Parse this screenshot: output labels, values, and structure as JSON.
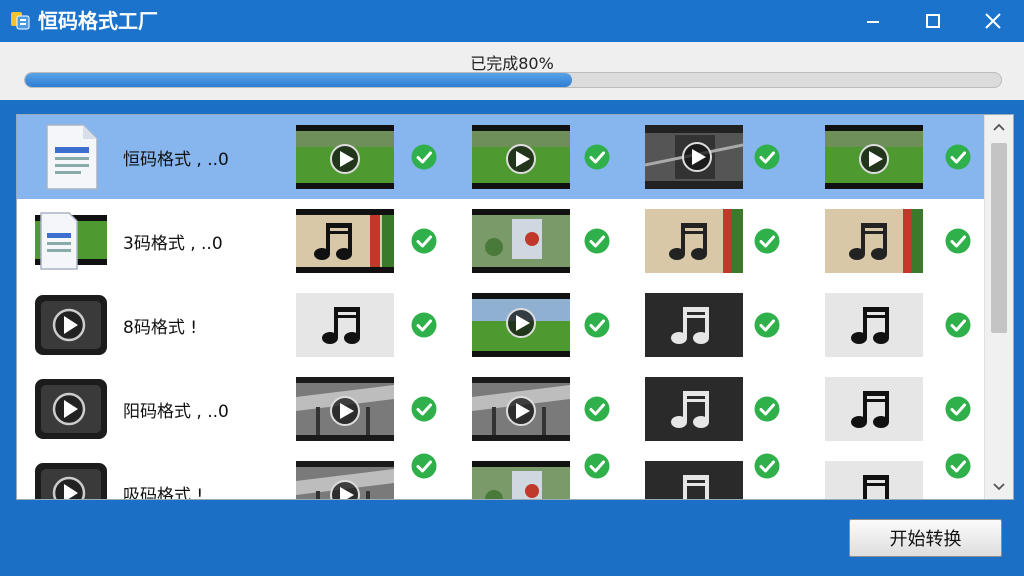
{
  "window": {
    "title": "恒码格式工厂",
    "controls": [
      "minimize-icon",
      "maximize-icon",
      "close-icon"
    ]
  },
  "progress": {
    "label": "已完成80%",
    "value": 0.56
  },
  "list": {
    "rows": [
      {
        "file_name": "恒码格式 ,  ..0",
        "source_icon": "document-icon",
        "selected": true,
        "outputs": [
          "video-thumb-grass",
          "video-thumb-grass",
          "video-thumb-dark-cut",
          "video-thumb-grass"
        ]
      },
      {
        "file_name": "3码格式 ,  ..0",
        "source_icon": "document-video-icon",
        "selected": false,
        "outputs": [
          "video-thumb-fence",
          "video-thumb-flowers",
          "music-thumb-fence",
          "music-thumb-fence"
        ]
      },
      {
        "file_name": "8码格式 !",
        "source_icon": "video-file-icon",
        "selected": false,
        "outputs": [
          "music-thumb-light",
          "video-thumb-field",
          "music-thumb-dark",
          "music-thumb-light"
        ]
      },
      {
        "file_name": "阳码格式 ,  ..0",
        "source_icon": "video-file-icon",
        "selected": false,
        "outputs": [
          "video-thumb-industrial",
          "video-thumb-industrial",
          "music-thumb-dark",
          "music-thumb-light"
        ]
      },
      {
        "file_name": "吸码格式 !",
        "source_icon": "video-file-icon",
        "selected": false,
        "outputs": [
          "video-thumb-industrial",
          "video-thumb-flowers",
          "music-thumb-dark",
          "music-thumb-light"
        ]
      }
    ]
  },
  "actions": {
    "start_label": "开始转换"
  },
  "colors": {
    "accent": "#1b73cc",
    "selected_row": "#87b6ee",
    "check": "#2fb04a",
    "progress_fill": "#3a88d8"
  }
}
